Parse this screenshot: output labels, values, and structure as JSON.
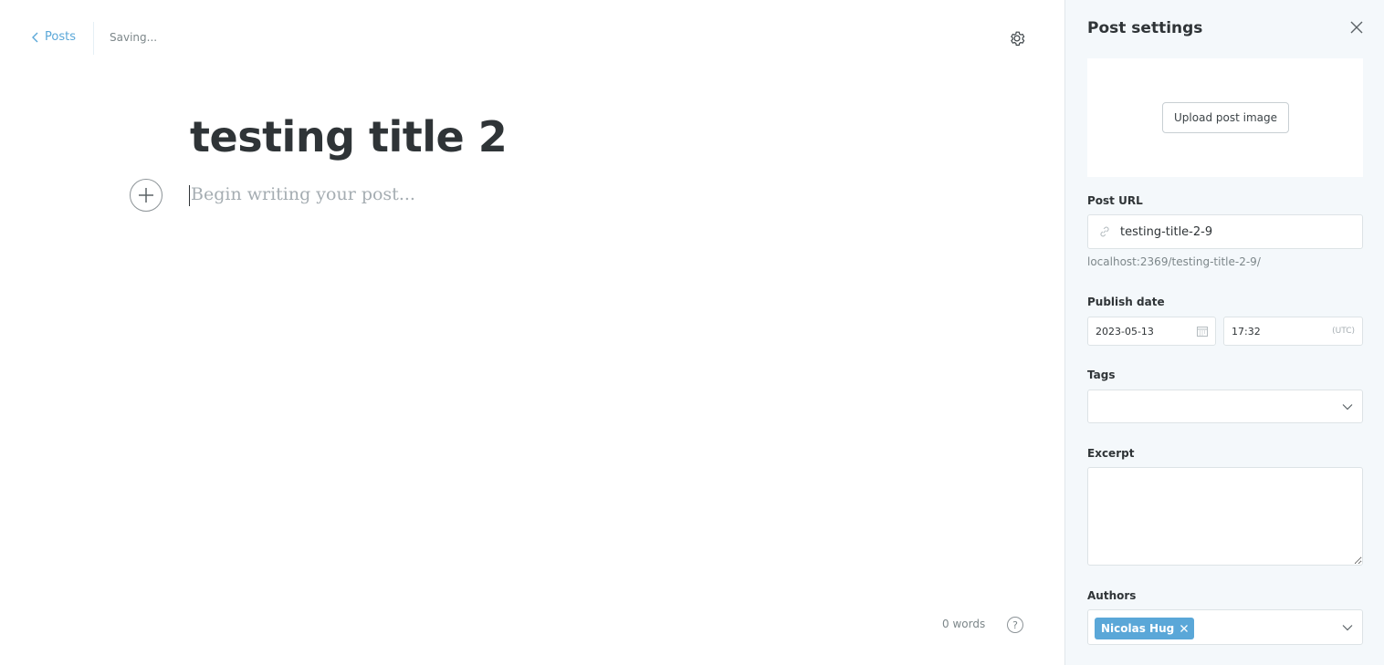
{
  "topbar": {
    "back_label": "Posts",
    "status": "Saving..."
  },
  "editor": {
    "title": "testing title 2",
    "body_placeholder": "Begin writing your post...",
    "word_count": "0 words",
    "help_label": "?"
  },
  "panel": {
    "title": "Post settings",
    "image": {
      "upload_label": "Upload post image"
    },
    "url": {
      "label": "Post URL",
      "value": "testing-title-2-9",
      "preview": "localhost:2369/testing-title-2-9/"
    },
    "publish": {
      "label": "Publish date",
      "date": "2023-05-13",
      "time": "17:32",
      "timezone": "(UTC)"
    },
    "tags": {
      "label": "Tags",
      "value": ""
    },
    "excerpt": {
      "label": "Excerpt",
      "value": ""
    },
    "authors": {
      "label": "Authors",
      "selected": [
        "Nicolas Hug"
      ]
    }
  },
  "colors": {
    "accent": "#5aa7d8",
    "panel_bg": "#f4f8fb",
    "title_text": "#2f3437",
    "muted_text": "#7d878a"
  },
  "icons": {
    "back": "chevron-left-icon",
    "settings": "gear-icon",
    "close": "close-icon",
    "add_card": "plus-icon",
    "link": "link-icon",
    "calendar": "calendar-icon",
    "select": "chevron-down-icon",
    "help": "question-icon",
    "remove": "x-icon"
  }
}
